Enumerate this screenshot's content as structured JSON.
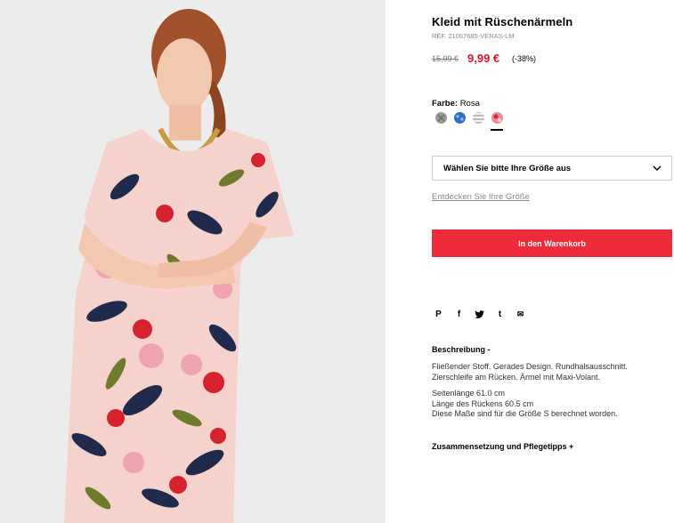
{
  "product": {
    "title": "Kleid mit Rüschenärmeln",
    "ref": "REF. 21067685-VERAS-LM",
    "old_price": "15,99 €",
    "new_price": "9,99 €",
    "discount": "(-38%)"
  },
  "color": {
    "label": "Farbe:",
    "selected": "Rosa",
    "swatches": [
      {
        "name": "grey-swatch",
        "color": "#9a9a9a"
      },
      {
        "name": "blue-swatch",
        "color": "#2f6ec4"
      },
      {
        "name": "stripe-swatch",
        "color": "#bbbbbb"
      },
      {
        "name": "rosa-swatch",
        "color": "#f08a9a"
      }
    ]
  },
  "size": {
    "placeholder": "Wählen Sie bitte Ihre Größe aus",
    "discover_link": "Entdecken Sie Ihre Größe"
  },
  "cart": {
    "button_label": "In den Warenkorb",
    "color": "#ee2b3b"
  },
  "share": {
    "pinterest": "P",
    "facebook": "f",
    "twitter": "t",
    "tumblr": "t",
    "email": "✉"
  },
  "description": {
    "heading": "Beschreibung -",
    "text_line1": "Fließender Stoff. Gerades Design. Rundhalsausschnitt.",
    "text_line2": "Zierschleife am Rücken. Ärmel mit Maxi-Volant.",
    "measure_line1": "Seitenlänge 61.0 cm",
    "measure_line2": "Länge des Rückens 60.5 cm",
    "measure_line3": "Diese Maße sind für die Größe S berechnet worden."
  },
  "composition": {
    "label": "Zusammensetzung und Pflegetipps +"
  }
}
